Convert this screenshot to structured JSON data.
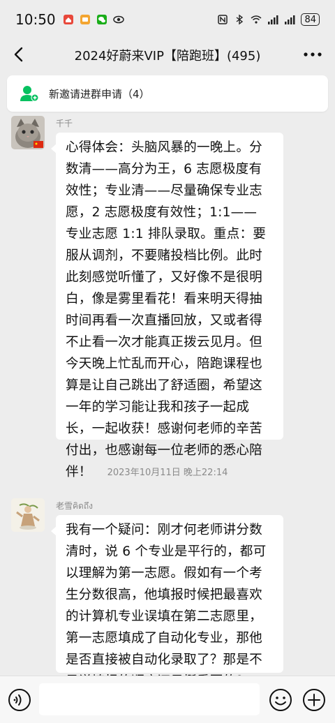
{
  "status_bar": {
    "time": "10:50",
    "battery": "84",
    "network_label": "6"
  },
  "nav": {
    "title": "2024好蔚来VIP【陪跑班】(495)"
  },
  "invite": {
    "text": "新邀请进群申请（4）"
  },
  "messages": [
    {
      "nickname": "千千",
      "lines": [
        "心得体会：头脑风暴的一晚上。分",
        "数清——高分为王，6 志愿极度有",
        "效性；专业清——尽量确保专业志",
        "愿，2 志愿极度有效性；1:1——",
        "专业志愿 1:1 排队录取。重点：要",
        "服从调剂，不要赌投档比例。此时",
        "此刻感觉听懂了，又好像不是很明",
        "白，像是雾里看花！看来明天得抽",
        "时间再看一次直播回放，又或者得",
        "不止看一次才能真正拨云见月。但",
        "今天晚上忙乱而开心，陪跑课程也",
        "算是让自己跳出了舒适圈，希望这",
        "一年的学习能让我和孩子一起成",
        "长，一起收获！感谢何老师的辛苦",
        "付出，也感谢每一位老师的悉心陪",
        "伴！"
      ]
    },
    {
      "nickname": "老雪คิดถึง",
      "lines": [
        "我有一个疑问：刚才何老师讲分数",
        "清时，说 6 个专业是平行的，都可",
        "以理解为第一志愿。假如有一个考",
        "生分数很高，他填报时候把最喜欢",
        "的计算机专业误填在第二志愿里，",
        "第一志愿填成了自动化专业，那他",
        "是否直接被自动化录取了？那是不",
        "是说填报的顺序还是挺重要的？"
      ]
    }
  ],
  "timestamp": "2023年10月11日 晚上22:14",
  "colors": {
    "background": "#ededed",
    "bubble": "#ffffff",
    "accent_green": "#07c160"
  },
  "icons": {
    "back": "chevron-left-icon",
    "more": "more-dots-icon",
    "invite": "add-user-icon",
    "voice": "voice-icon",
    "emoji": "emoji-icon",
    "plus": "plus-icon"
  }
}
